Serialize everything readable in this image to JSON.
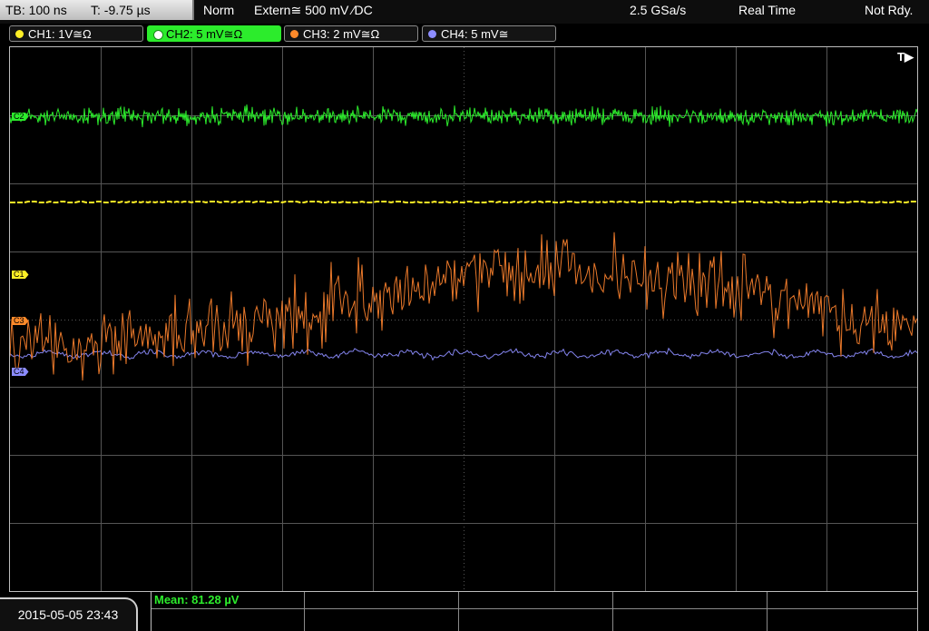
{
  "status": {
    "timebase": "TB: 100 ns",
    "trigger_time": "T: -9.75 µs",
    "mode": "Norm",
    "trigger_source": "Extern≅ 500 mV ⁄DC",
    "sample_rate": "2.5 GSa/s",
    "acq_mode": "Real Time",
    "ready": "Not Rdy."
  },
  "channels": [
    {
      "label": "CH1: 1V≅Ω",
      "color": "#ffef26",
      "active": false
    },
    {
      "label": "CH2: 5 mV≅Ω",
      "color": "#2cec2c",
      "active": true
    },
    {
      "label": "CH3: 2 mV≅Ω",
      "color": "#ff8a2a",
      "active": false
    },
    {
      "label": "CH4: 5 mV≅",
      "color": "#8c8cff",
      "active": false
    }
  ],
  "screen": {
    "trigger_marker": "T▶",
    "level_markers": [
      "C2",
      "C1",
      "C3",
      "C4"
    ],
    "colors": {
      "grid": "#555555",
      "ch1": "#ffef26",
      "ch2": "#2cec2c",
      "ch3": "#e9782a",
      "ch4": "#8484ee"
    }
  },
  "measurement": {
    "mean_label": "Mean: 81.28 µV"
  },
  "footer": {
    "datetime": "2015-05-05 23:43"
  }
}
